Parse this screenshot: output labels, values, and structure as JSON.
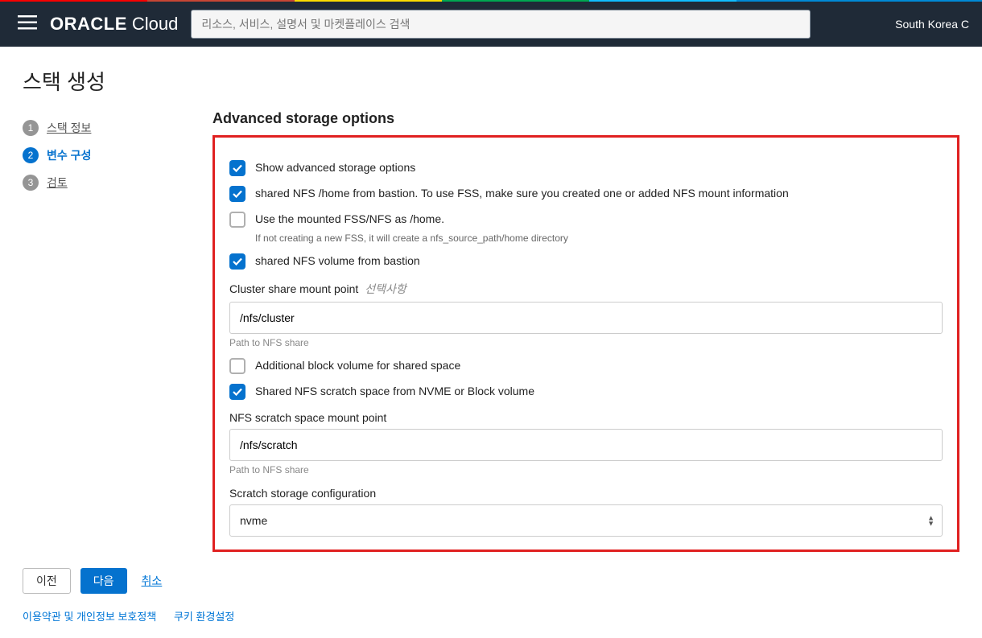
{
  "header": {
    "brand_strong": "ORACLE",
    "brand_light": "Cloud",
    "search_placeholder": "리소스, 서비스, 설명서 및 마켓플레이스 검색",
    "region": "South Korea C"
  },
  "page_title": "스택 생성",
  "steps": [
    {
      "num": "1",
      "label": "스택 정보",
      "state": "inactive"
    },
    {
      "num": "2",
      "label": "변수 구성",
      "state": "active"
    },
    {
      "num": "3",
      "label": "검토",
      "state": "inactive"
    }
  ],
  "section": {
    "title": "Advanced storage options",
    "cbx_show": "Show advanced storage options",
    "cbx_shared_home": "shared NFS /home from bastion. To use FSS, make sure you created one or added NFS mount information",
    "cbx_use_mounted": "Use the mounted FSS/NFS as /home.",
    "cbx_use_mounted_help": "If not creating a new FSS, it will create a nfs_source_path/home directory",
    "cbx_shared_vol": "shared NFS volume from bastion",
    "cluster_label": "Cluster share mount point",
    "cluster_opt": "선택사항",
    "cluster_value": "/nfs/cluster",
    "cluster_help": "Path to NFS share",
    "cbx_add_block": "Additional block volume for shared space",
    "cbx_scratch": "Shared NFS scratch space from NVME or Block volume",
    "scratch_label": "NFS scratch space mount point",
    "scratch_value": "/nfs/scratch",
    "scratch_help": "Path to NFS share",
    "storage_config_label": "Scratch storage configuration",
    "storage_config_value": "nvme"
  },
  "footer": {
    "prev": "이전",
    "next": "다음",
    "cancel": "취소"
  },
  "legal": {
    "terms": "이용약관 및 개인정보 보호정책",
    "cookies": "쿠키 환경설정"
  }
}
